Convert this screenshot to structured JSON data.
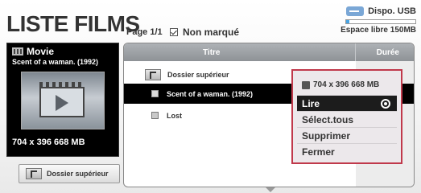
{
  "header": {
    "title": "LISTE FILMS",
    "page_info": "Page 1/1",
    "filter_label": "Non marqué"
  },
  "usb": {
    "label": "Dispo. USB",
    "free_space": "Espace libre 150MB",
    "usage_fraction": 0.05,
    "accent": "#47a3e3"
  },
  "preview": {
    "category": "Movie",
    "name": "Scent of a waman. (1992)",
    "meta": "704 x 396  668 MB"
  },
  "up_button": {
    "label": "Dossier supérieur"
  },
  "list": {
    "columns": {
      "title": "Titre",
      "duration": "Durée"
    },
    "parent_label": "Dossier supérieur",
    "rows": [
      {
        "name": "Scent of a waman. (1992)",
        "selected": true
      },
      {
        "name": "Lost",
        "selected": false
      }
    ]
  },
  "popup": {
    "info": "704 x 396  668 MB",
    "items": [
      "Lire",
      "Sélect.tous",
      "Supprimer",
      "Fermer"
    ],
    "border_color": "#c0394b"
  }
}
